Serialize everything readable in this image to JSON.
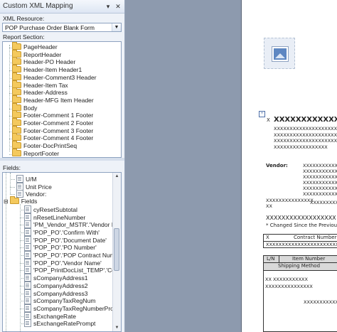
{
  "pane": {
    "title": "Custom XML Mapping",
    "pin_glyph": "▾",
    "close_glyph": "✕",
    "xml_resource_label": "XML Resource:",
    "xml_resource_value": "POP Purchase Order Blank Form",
    "report_section_label": "Report Section:",
    "report_sections": [
      "PageHeader",
      "ReportHeader",
      "Header-PO Header",
      "Header-Item Header1",
      "Header-Comment3 Header",
      "Header-Item Tax",
      "Header-Address",
      "Header-MFG Item Header",
      "Body",
      "Footer-Comment 1 Footer",
      "Footer-Comment 2 Footer",
      "Footer-Comment 3 Footer",
      "Footer-Comment 4 Footer",
      "Footer-DocPrintSeq",
      "ReportFooter"
    ],
    "fields_label": "Fields:",
    "field_items_top": [
      "U/M",
      "Unit Price",
      "Vendor:"
    ],
    "fields_folder": "Fields",
    "field_items": [
      "cyResetSubtotal",
      "nResetLineNumber",
      "'PM_Vendor_MSTR'.'Vendor ID'",
      "'POP_PO'.'Confirm With'",
      "'POP_PO'.'Document Date'",
      "'POP_PO'.'PO Number'",
      "'POP_PO'.'POP Contract Number'",
      "'POP_PO'.'Vendor Name'",
      "'POP_PrintDocList_TEMP'.'Company",
      "sCompanyAddress1",
      "sCompanyAddress2",
      "sCompanyAddress3",
      "sCompanyTaxRegNum",
      "sCompanyTaxRegNumberPrompt",
      "sExchangeRate",
      "sExchangeRatePrompt"
    ]
  },
  "document": {
    "x_label": "X",
    "x_heading": "XXXXXXXXXXXXXXX",
    "x_lines": [
      "XXXXXXXXXXXXXXXXXXXXX",
      "XXXXXXXXXXXXXXXXXXXXX",
      "XXXXXXXXXXXXXXXXXXXXX",
      "XXXXXXXXXXXXXXXXX"
    ],
    "vendor_label": "Vendor:",
    "vendor_lines": [
      "XXXXXXXXXXXXXXX",
      "XXXXXXXXXXXXXXX",
      "XXXXXXXXXXXXXXX",
      "XXXXXXXXXXXXXXX",
      "XXXXXXXXXXXXXXX",
      "XXXXXXXXXXXXXXX"
    ],
    "mid_line1": "XXXXXXXXXXXXXXX",
    "mid_line1b": "XX",
    "mid_line1c": "XXXXXXXXXXXX",
    "mid_line2": "XXXXXXXXXXXXXXXXXX",
    "changed_note": "*  Changed Since the Previous",
    "table1_col1": "X",
    "table1_col2": "Contract Number",
    "table1_row": "XXXXXXXXXXXXXXXXXXXXXXXXXX",
    "table2_col1": "L/N",
    "table2_col2": "Item Number",
    "table2_sub": "Shipping Method",
    "table2_rows": [
      "XX        XXXXXXXXXXX",
      "XXXXXXXXXXXXXXX",
      "XXXXXXXXXXXX"
    ]
  },
  "colors": {
    "pane_bg": "#eef2f8",
    "doc_bg": "#8d9aae",
    "folder": "#f4c95d"
  }
}
